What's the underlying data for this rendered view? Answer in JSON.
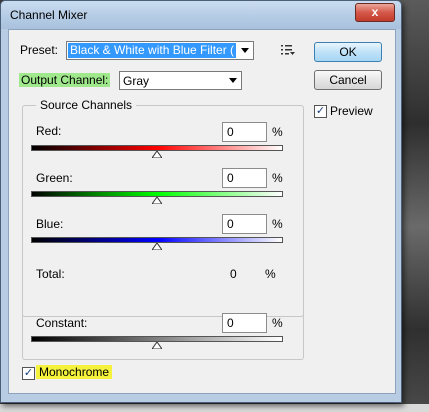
{
  "window": {
    "title": "Channel Mixer",
    "close_label": "x"
  },
  "preset": {
    "label": "Preset:",
    "value": "Black & White with Blue Filter ("
  },
  "output_channel": {
    "label": "Output Channel:",
    "value": "Gray"
  },
  "buttons": {
    "ok": "OK",
    "cancel": "Cancel"
  },
  "preview": {
    "label": "Preview",
    "checked": true
  },
  "source_channels": {
    "title": "Source Channels",
    "channels": [
      {
        "label": "Red:",
        "value": "0",
        "unit": "%",
        "gradient": [
          "#000000",
          "#ff0000",
          "#ffffff"
        ]
      },
      {
        "label": "Green:",
        "value": "0",
        "unit": "%",
        "gradient": [
          "#000000",
          "#00ff00",
          "#ffffff"
        ]
      },
      {
        "label": "Blue:",
        "value": "0",
        "unit": "%",
        "gradient": [
          "#000000",
          "#0000ff",
          "#ffffff"
        ]
      }
    ],
    "total": {
      "label": "Total:",
      "value": "0",
      "unit": "%"
    }
  },
  "constant": {
    "label": "Constant:",
    "value": "0",
    "unit": "%",
    "gradient": [
      "#000000",
      "#ffffff"
    ]
  },
  "monochrome": {
    "label": "Monochrome",
    "checked": true
  },
  "colors": {
    "highlight_green": "#9fe88c",
    "highlight_yellow": "#f4f23c",
    "selection_blue": "#3399ff"
  }
}
